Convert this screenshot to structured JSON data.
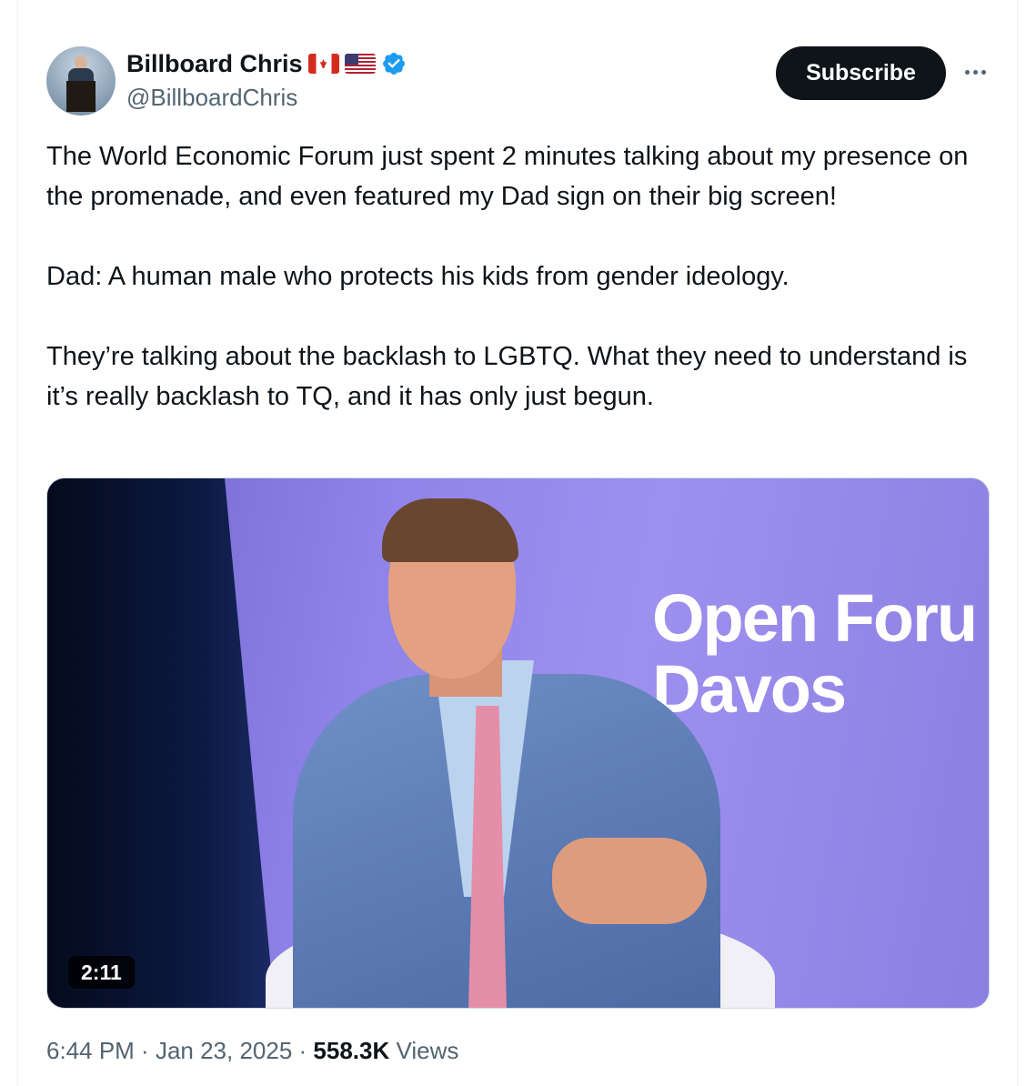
{
  "author": {
    "display_name": "Billboard Chris",
    "handle": "@BillboardChris",
    "flags": [
      "canada-flag",
      "usa-flag"
    ],
    "verified": true
  },
  "subscribe_label": "Subscribe",
  "tweet": {
    "paragraphs": [
      "The World Economic Forum just spent 2 minutes talking about my presence on the promenade, and even featured my Dad sign on their big screen!",
      "",
      "Dad: A human male who protects his kids from gender ideology.",
      "",
      "They’re talking about the backlash to LGBTQ. What they need to understand is it’s really backlash to TQ, and it has only just begun."
    ]
  },
  "media": {
    "type": "video",
    "duration": "2:11",
    "screen_text": "Open Foru\nDavos"
  },
  "meta": {
    "time": "6:44 PM",
    "separator": " · ",
    "date": "Jan 23, 2025",
    "views_count": "558.3K",
    "views_label": " Views"
  },
  "colors": {
    "text": "#0f1419",
    "secondary": "#536471",
    "verified": "#1d9bf0",
    "button": "#0f1419"
  }
}
